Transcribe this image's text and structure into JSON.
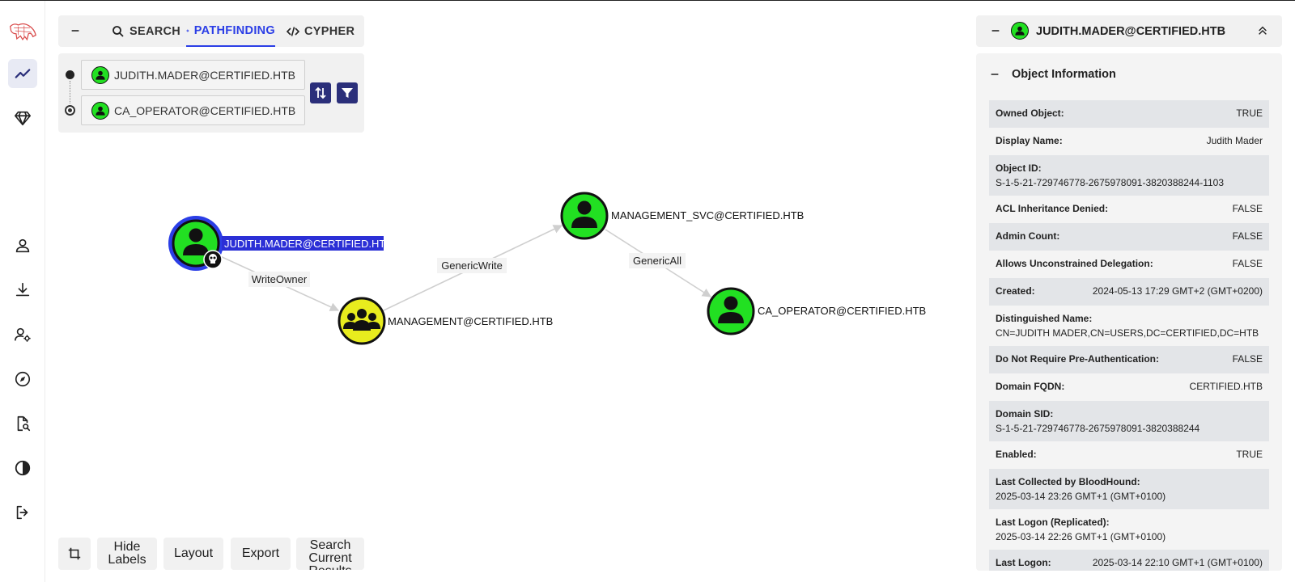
{
  "nav": {
    "items": [
      {
        "name": "explore-icon"
      },
      {
        "name": "group-management-icon"
      },
      {
        "name": "user-icon"
      },
      {
        "name": "download-icon"
      },
      {
        "name": "admin-settings-icon"
      },
      {
        "name": "compass-icon"
      },
      {
        "name": "file-search-icon"
      },
      {
        "name": "dark-mode-icon"
      },
      {
        "name": "logout-icon"
      }
    ]
  },
  "tabs": {
    "search": "SEARCH",
    "pathfinding": "PATHFINDING",
    "cypher": "CYPHER"
  },
  "pathfinding": {
    "source": "JUDITH.MADER@CERTIFIED.HTB",
    "destination": "CA_OPERATOR@CERTIFIED.HTB"
  },
  "graph": {
    "nodes": {
      "judith": "JUDITH.MADER@CERTIFIED.HTB",
      "management": "MANAGEMENT@CERTIFIED.HTB",
      "management_svc": "MANAGEMENT_SVC@CERTIFIED.HTB",
      "ca_operator": "CA_OPERATOR@CERTIFIED.HTB"
    },
    "edges": {
      "e1": "WriteOwner",
      "e2": "GenericWrite",
      "e3": "GenericAll"
    },
    "colors": {
      "user": "#22e022",
      "group": "#e8ec1e",
      "selected_ring": "#2b3ee6",
      "label_highlight": "#2b2fd6"
    }
  },
  "toolbar": {
    "hide_labels": "Hide Labels",
    "layout": "Layout",
    "export": "Export",
    "search_results": "Search Current Results"
  },
  "entity": {
    "title": "JUDITH.MADER@CERTIFIED.HTB",
    "section": "Object Information",
    "props": [
      {
        "k": "Owned Object:",
        "v": "TRUE"
      },
      {
        "k": "Display Name:",
        "v": "Judith Mader"
      },
      {
        "k": "Object ID:",
        "v": "S-1-5-21-729746778-2675978091-3820388244-1103",
        "stack": true
      },
      {
        "k": "ACL Inheritance Denied:",
        "v": "FALSE"
      },
      {
        "k": "Admin Count:",
        "v": "FALSE"
      },
      {
        "k": "Allows Unconstrained Delegation:",
        "v": "FALSE"
      },
      {
        "k": "Created:",
        "v": "2024-05-13 17:29 GMT+2 (GMT+0200)"
      },
      {
        "k": "Distinguished Name:",
        "v": "CN=JUDITH MADER,CN=USERS,DC=CERTIFIED,DC=HTB",
        "stack": true
      },
      {
        "k": "Do Not Require Pre-Authentication:",
        "v": "FALSE"
      },
      {
        "k": "Domain FQDN:",
        "v": "CERTIFIED.HTB"
      },
      {
        "k": "Domain SID:",
        "v": "S-1-5-21-729746778-2675978091-3820388244",
        "stack": true
      },
      {
        "k": "Enabled:",
        "v": "TRUE"
      },
      {
        "k": "Last Collected by BloodHound:",
        "v": "2025-03-14 23:26 GMT+1 (GMT+0100)",
        "stack": true
      },
      {
        "k": "Last Logon (Replicated):",
        "v": "2025-03-14 22:26 GMT+1 (GMT+0100)",
        "stack": true
      },
      {
        "k": "Last Logon:",
        "v": "2025-03-14 22:10 GMT+1 (GMT+0100)"
      }
    ]
  }
}
